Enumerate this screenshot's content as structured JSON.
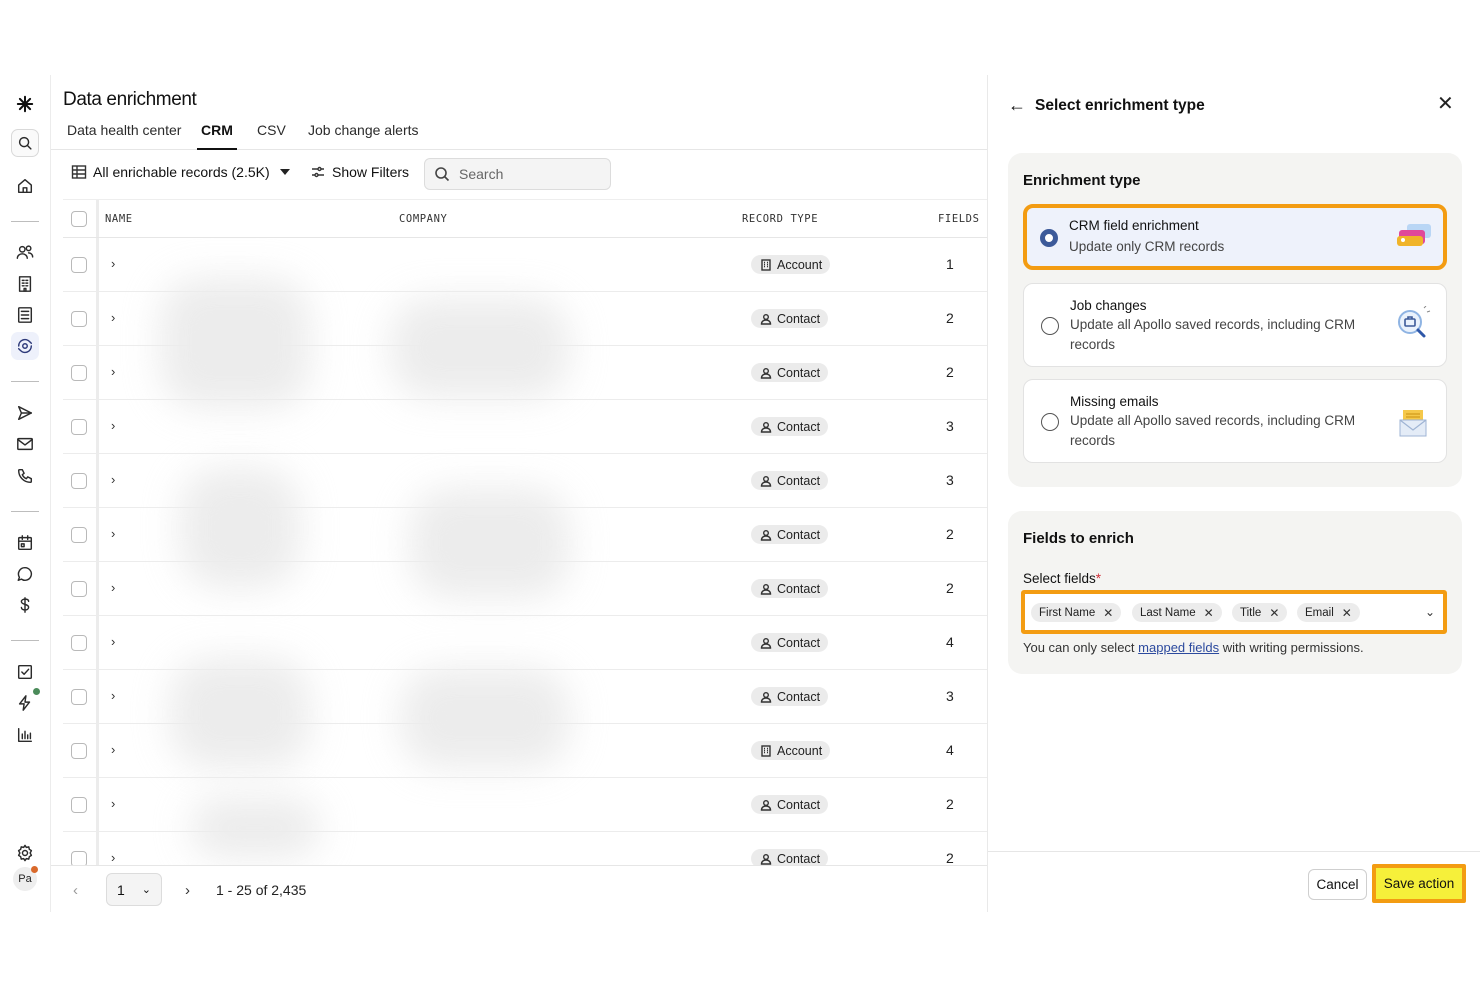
{
  "page": {
    "title": "Data enrichment"
  },
  "tabs": [
    {
      "label": "Data health center"
    },
    {
      "label": "CRM"
    },
    {
      "label": "CSV"
    },
    {
      "label": "Job change alerts"
    }
  ],
  "toolbar": {
    "view_label": "All enrichable records (2.5K)",
    "filters_label": "Show Filters",
    "search_placeholder": "Search"
  },
  "table": {
    "columns": [
      "NAME",
      "COMPANY",
      "RECORD TYPE",
      "FIELDS"
    ],
    "rows": [
      {
        "record_type": "Account",
        "fields": "1"
      },
      {
        "record_type": "Contact",
        "fields": "2"
      },
      {
        "record_type": "Contact",
        "fields": "2"
      },
      {
        "record_type": "Contact",
        "fields": "3"
      },
      {
        "record_type": "Contact",
        "fields": "3"
      },
      {
        "record_type": "Contact",
        "fields": "2"
      },
      {
        "record_type": "Contact",
        "fields": "2"
      },
      {
        "record_type": "Contact",
        "fields": "4"
      },
      {
        "record_type": "Contact",
        "fields": "3"
      },
      {
        "record_type": "Account",
        "fields": "4"
      },
      {
        "record_type": "Contact",
        "fields": "2"
      },
      {
        "record_type": "Contact",
        "fields": "2"
      }
    ]
  },
  "pagination": {
    "page": "1",
    "range": "1 - 25 of 2,435"
  },
  "panel": {
    "title": "Select enrichment type",
    "enrichment_card_title": "Enrichment type",
    "options": [
      {
        "title": "CRM field enrichment",
        "desc": "Update only CRM records",
        "selected": true
      },
      {
        "title": "Job changes",
        "desc": "Update all Apollo saved records, including CRM records",
        "selected": false
      },
      {
        "title": "Missing emails",
        "desc": "Update all Apollo saved records, including CRM records",
        "selected": false
      }
    ],
    "fields_card_title": "Fields to enrich",
    "select_fields_label": "Select fields",
    "required_mark": "*",
    "selected_fields": [
      "First Name",
      "Last Name",
      "Title",
      "Email"
    ],
    "hint_prefix": "You can only select",
    "hint_link": "mapped fields",
    "hint_suffix": "with writing permissions.",
    "cancel_label": "Cancel",
    "save_label": "Save action"
  },
  "colors": {
    "highlight": "#f39c12",
    "save_button_bg": "#f6f03a",
    "link": "#2c4a9e",
    "radio_selected": "#3c5a99"
  }
}
